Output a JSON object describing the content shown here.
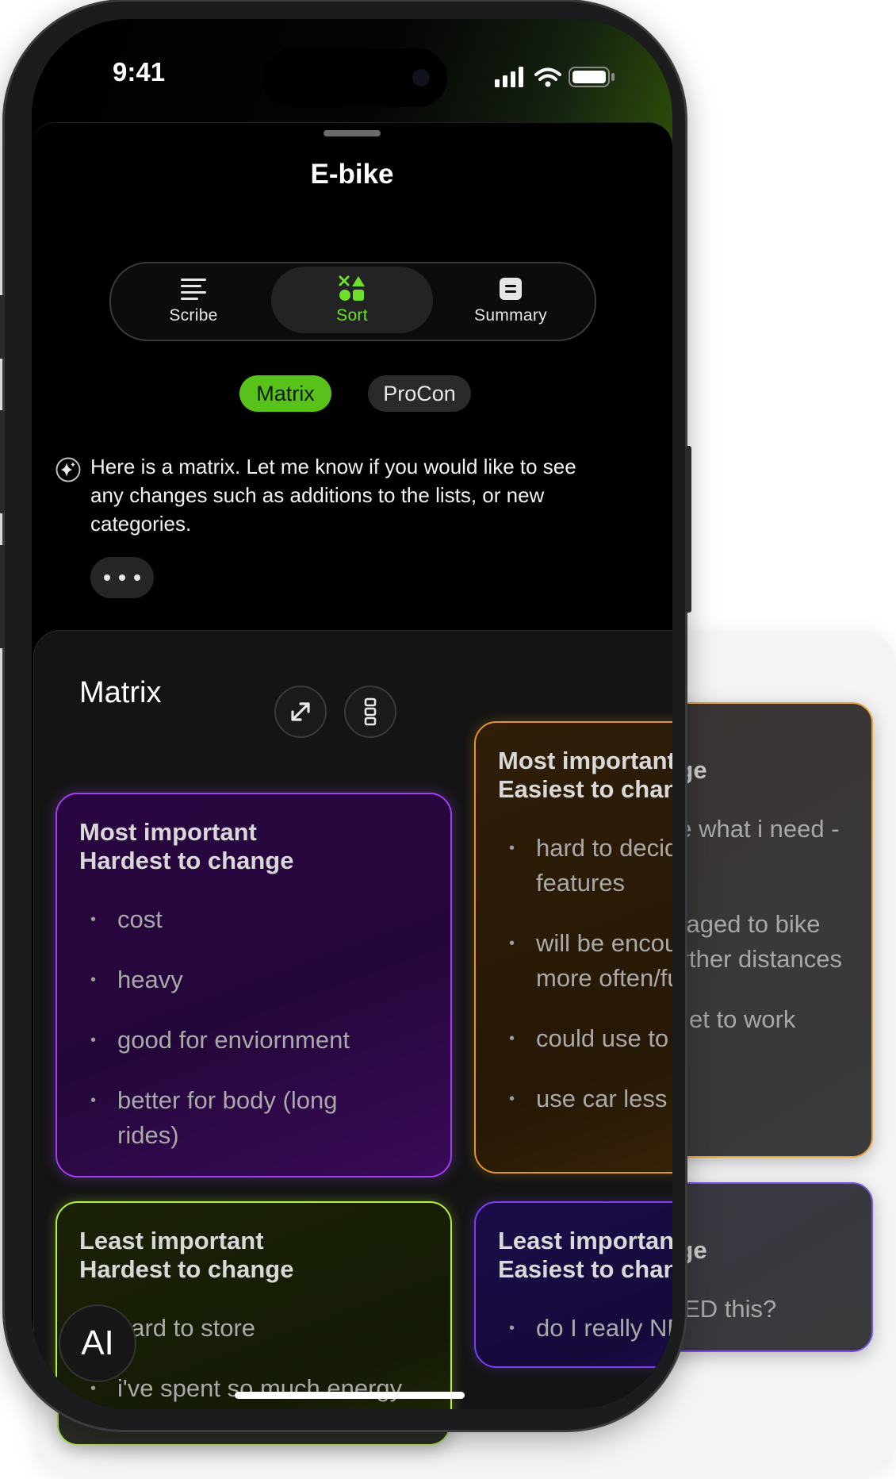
{
  "status_bar": {
    "time": "9:41"
  },
  "header": {
    "title": "E-bike"
  },
  "segments": [
    {
      "label": "Scribe",
      "icon": "lines-icon",
      "active": false
    },
    {
      "label": "Sort",
      "icon": "shapes-icon",
      "active": true
    },
    {
      "label": "Summary",
      "icon": "summary-icon",
      "active": false
    }
  ],
  "chips": [
    {
      "label": "Matrix",
      "active": true
    },
    {
      "label": "ProCon",
      "active": false
    }
  ],
  "assistant": {
    "message": "Here is a matrix. Let me know if you would like to see any changes such as additions to the lists, or new categories."
  },
  "matrix": {
    "title": "Matrix",
    "quadrants": [
      {
        "title_line1": "Most important",
        "title_line2": "Hardest to change",
        "color": "#a13ef2",
        "items": [
          "cost",
          "heavy",
          "good for enviornment",
          "better for body (long rides)"
        ]
      },
      {
        "title_line1": "Most important",
        "title_line2": "Easiest to change",
        "color": "#e0952c",
        "items": [
          "hard to decide what i need - features",
          "will be encouraged to bike more often/further distances",
          "could use to get to work",
          "use car less"
        ]
      },
      {
        "title_line1": "Least important",
        "title_line2": "Hardest to change",
        "color": "#b7ef3c",
        "items": [
          "hard to store",
          "i've spent so much energy on this"
        ]
      },
      {
        "title_line1": "Least important",
        "title_line2": "Easiest to change",
        "color": "#7b3ff0",
        "items": [
          "do I really NEED this?"
        ]
      }
    ]
  },
  "fab": {
    "label": "AI"
  }
}
